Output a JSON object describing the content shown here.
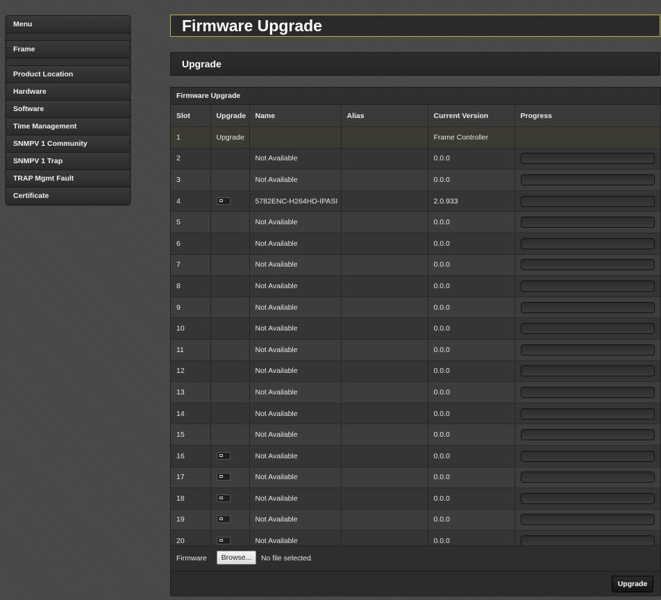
{
  "sidebar": {
    "items": [
      {
        "label": "Menu"
      },
      {
        "label": "Frame"
      },
      {
        "label": "Product Location"
      },
      {
        "label": "Hardware"
      },
      {
        "label": "Software"
      },
      {
        "label": "Time Management"
      },
      {
        "label": "SNMPV 1 Community"
      },
      {
        "label": "SNMPV 1 Trap"
      },
      {
        "label": "TRAP Mgmt Fault"
      },
      {
        "label": "Certificate"
      }
    ]
  },
  "page_title": "Firmware Upgrade",
  "section_title": "Upgrade",
  "panel": {
    "title": "Firmware Upgrade",
    "columns": [
      "Slot",
      "Upgrade",
      "Name",
      "Alias",
      "Current Version",
      "Progress"
    ],
    "first_row": {
      "slot": "1",
      "upgrade_link": "Upgrade",
      "note": "Frame Controller"
    },
    "rows": [
      {
        "slot": "2",
        "has_button": false,
        "name": "Not Available",
        "alias": "",
        "version": "0.0.0",
        "progress": 0
      },
      {
        "slot": "3",
        "has_button": false,
        "name": "Not Available",
        "alias": "",
        "version": "0.0.0",
        "progress": 0
      },
      {
        "slot": "4",
        "has_button": true,
        "name": "5782ENC-H264HD-IPASI",
        "alias": "",
        "version": "2.0.933",
        "progress": 0
      },
      {
        "slot": "5",
        "has_button": false,
        "name": "Not Available",
        "alias": "",
        "version": "0.0.0",
        "progress": 0
      },
      {
        "slot": "6",
        "has_button": false,
        "name": "Not Available",
        "alias": "",
        "version": "0.0.0",
        "progress": 0
      },
      {
        "slot": "7",
        "has_button": false,
        "name": "Not Available",
        "alias": "",
        "version": "0.0.0",
        "progress": 0
      },
      {
        "slot": "8",
        "has_button": false,
        "name": "Not Available",
        "alias": "",
        "version": "0.0.0",
        "progress": 0
      },
      {
        "slot": "9",
        "has_button": false,
        "name": "Not Available",
        "alias": "",
        "version": "0.0.0",
        "progress": 0
      },
      {
        "slot": "10",
        "has_button": false,
        "name": "Not Available",
        "alias": "",
        "version": "0.0.0",
        "progress": 0
      },
      {
        "slot": "11",
        "has_button": false,
        "name": "Not Available",
        "alias": "",
        "version": "0.0.0",
        "progress": 0
      },
      {
        "slot": "12",
        "has_button": false,
        "name": "Not Available",
        "alias": "",
        "version": "0.0.0",
        "progress": 0
      },
      {
        "slot": "13",
        "has_button": false,
        "name": "Not Available",
        "alias": "",
        "version": "0.0.0",
        "progress": 0
      },
      {
        "slot": "14",
        "has_button": false,
        "name": "Not Available",
        "alias": "",
        "version": "0.0.0",
        "progress": 0
      },
      {
        "slot": "15",
        "has_button": false,
        "name": "Not Available",
        "alias": "",
        "version": "0.0.0",
        "progress": 0
      },
      {
        "slot": "16",
        "has_button": true,
        "name": "Not Available",
        "alias": "",
        "version": "0.0.0",
        "progress": 0
      },
      {
        "slot": "17",
        "has_button": true,
        "name": "Not Available",
        "alias": "",
        "version": "0.0.0",
        "progress": 0
      },
      {
        "slot": "18",
        "has_button": true,
        "name": "Not Available",
        "alias": "",
        "version": "0.0.0",
        "progress": 0
      },
      {
        "slot": "19",
        "has_button": true,
        "name": "Not Available",
        "alias": "",
        "version": "0.0.0",
        "progress": 0
      },
      {
        "slot": "20",
        "has_button": true,
        "name": "Not Available",
        "alias": "",
        "version": "0.0.0",
        "progress": 0
      }
    ],
    "firmware_label": "Firmware",
    "browse_label": "Browse...",
    "file_status": "No file selected.",
    "upgrade_button": "Upgrade"
  },
  "colors": {
    "accent_yellow": "#cfcf3a",
    "background": "#484848",
    "panel": "#333333"
  }
}
